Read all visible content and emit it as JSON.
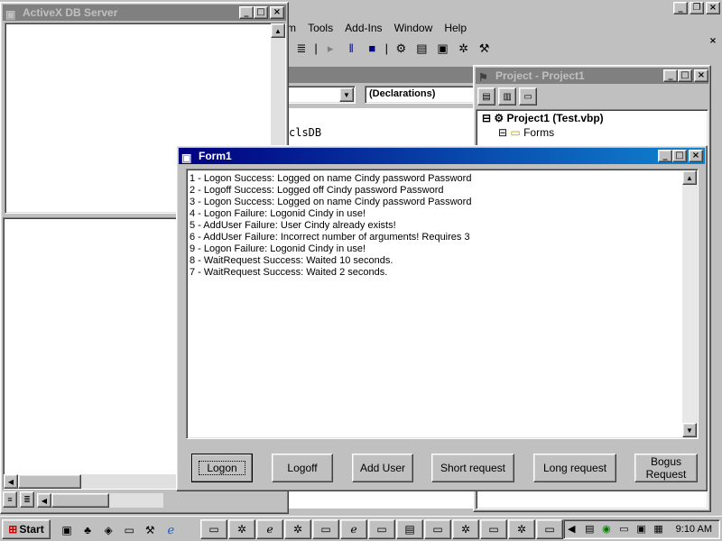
{
  "ide": {
    "menu": [
      {
        "label": "m"
      },
      {
        "label": "Tools"
      },
      {
        "label": "Add-Ins"
      },
      {
        "label": "Window"
      },
      {
        "label": "Help"
      }
    ],
    "combo_left_value": "",
    "combo_right_value": "(Declarations)",
    "code_text": "clsDB",
    "toolbar_icons": [
      "properties-icon",
      "run-icon",
      "pause-icon",
      "stop-icon",
      "project-explorer-icon",
      "properties-window-icon",
      "form-layout-icon",
      "object-browser-icon",
      "toolbox-icon"
    ]
  },
  "activex_window": {
    "title": "ActiveX DB Server"
  },
  "project_window": {
    "title": "Project - Project1",
    "tree": {
      "root": "Project1 (Test.vbp)",
      "child": "Forms"
    }
  },
  "form1": {
    "title": "Form1",
    "log_lines": [
      "1 - Logon Success: Logged on name Cindy password Password",
      "2 - Logoff Success: Logged off Cindy password Password",
      "3 - Logon Success: Logged on name Cindy password Password",
      "4 - Logon Failure: Logonid Cindy in use!",
      "5 - AddUser Failure: User Cindy already exists!",
      "6 - AddUser Failure: Incorrect number of arguments! Requires 3",
      "9 - Logon Failure: Logonid Cindy in use!",
      "8 - WaitRequest Success: Waited 10 seconds.",
      "7 - WaitRequest Success: Waited 2 seconds."
    ],
    "buttons": {
      "logon": "Logon",
      "logoff": "Logoff",
      "add_user": "Add User",
      "short_request": "Short request",
      "long_request": "Long request",
      "bogus_request_line1": "Bogus",
      "bogus_request_line2": "Request"
    }
  },
  "taskbar": {
    "start_label": "Start",
    "clock": "9:10 AM",
    "task_buttons": [
      "folder",
      "wizard",
      "browser",
      "wizard",
      "folder",
      "browser",
      "folder",
      "computer",
      "folder",
      "wizard",
      "window",
      "wizard",
      "window",
      "window"
    ]
  },
  "colors": {
    "desktop_gray": "#c0c0c0",
    "active_title": "#000080",
    "inactive_title": "#808080"
  }
}
